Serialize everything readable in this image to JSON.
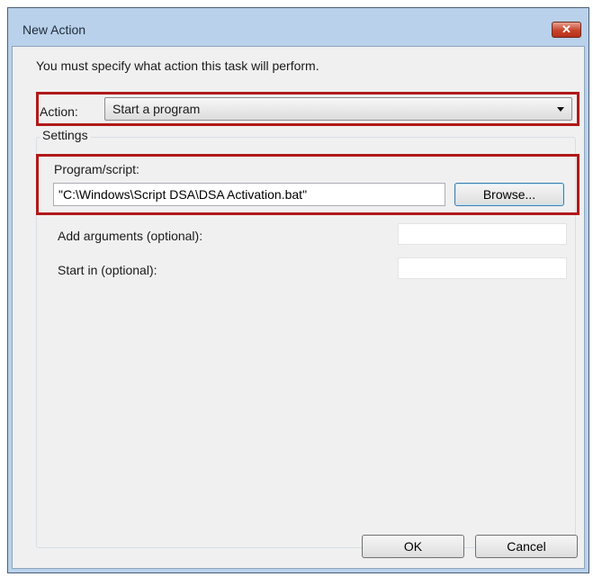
{
  "window": {
    "title": "New Action",
    "close_glyph": "✕"
  },
  "instruction": "You must specify what action this task will perform.",
  "action": {
    "label": "Action:",
    "selected": "Start a program"
  },
  "settings": {
    "caption": "Settings",
    "program_label": "Program/script:",
    "program_value": "\"C:\\Windows\\Script DSA\\DSA Activation.bat\"",
    "browse_label": "Browse...",
    "arguments_label": "Add arguments (optional):",
    "arguments_value": "",
    "start_in_label": "Start in (optional):",
    "start_in_value": ""
  },
  "buttons": {
    "ok": "OK",
    "cancel": "Cancel"
  },
  "colors": {
    "highlight": "#b01a1a",
    "titlebar": "#b9d1ea",
    "client": "#f0f0f0"
  }
}
